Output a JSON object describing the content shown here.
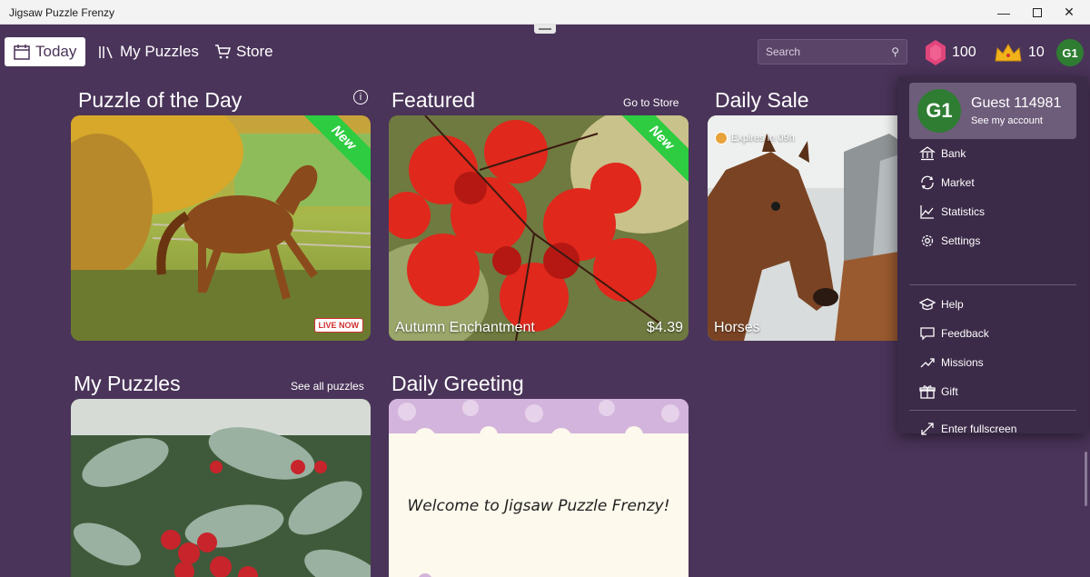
{
  "window": {
    "title": "Jigsaw Puzzle Frenzy"
  },
  "nav": {
    "today": "Today",
    "my_puzzles": "My Puzzles",
    "store": "Store"
  },
  "search": {
    "placeholder": "Search"
  },
  "currency": {
    "gems": "100",
    "crowns": "10"
  },
  "user": {
    "initials": "G1",
    "name": "Guest 114981",
    "account_link": "See my account"
  },
  "sections": {
    "potd": {
      "title": "Puzzle of the Day",
      "badge": "New",
      "live": "LIVE NOW"
    },
    "featured": {
      "title": "Featured",
      "link": "Go to Store",
      "badge": "New",
      "caption": "Autumn Enchantment",
      "price": "$4.39"
    },
    "sale": {
      "title": "Daily Sale",
      "expires": "Expires in 09h",
      "caption": "Horses"
    },
    "my_puzzles": {
      "title": "My Puzzles",
      "link": "See all puzzles"
    },
    "greeting": {
      "title": "Daily Greeting",
      "text": "Welcome to Jigsaw Puzzle Frenzy!"
    }
  },
  "menu": {
    "items": [
      "Bank",
      "Market",
      "Statistics",
      "Settings",
      "Help",
      "Feedback",
      "Missions",
      "Gift",
      "Enter fullscreen"
    ]
  },
  "colors": {
    "background": "#4a3459",
    "new_ribbon": "#2ecc40",
    "avatar": "#2e7d32",
    "gem": "#e0457b",
    "crown": "#f2b21a"
  }
}
